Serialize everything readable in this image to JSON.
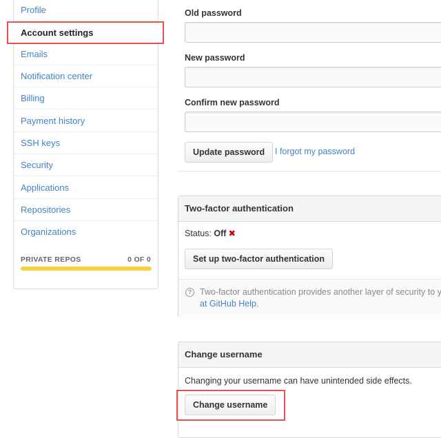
{
  "sidebar": {
    "items": [
      {
        "label": "Profile"
      },
      {
        "label": "Account settings"
      },
      {
        "label": "Emails"
      },
      {
        "label": "Notification center"
      },
      {
        "label": "Billing"
      },
      {
        "label": "Payment history"
      },
      {
        "label": "SSH keys"
      },
      {
        "label": "Security"
      },
      {
        "label": "Applications"
      },
      {
        "label": "Repositories"
      },
      {
        "label": "Organizations"
      }
    ],
    "selected": "Account settings",
    "private_repos": {
      "label": "PRIVATE REPOS",
      "count": "0 OF 0",
      "fill": 1.0,
      "bar_color": "#f5d23b"
    }
  },
  "password": {
    "old_label": "Old password",
    "new_label": "New password",
    "confirm_label": "Confirm new password",
    "update_button": "Update password",
    "forgot_link": "I forgot my password"
  },
  "two_factor": {
    "title": "Two-factor authentication",
    "status_label": "Status:",
    "status_value": "Off",
    "status_icon": "x-icon",
    "setup_button": "Set up two-factor authentication",
    "help_line1": "Two-factor authentication provides another layer of security to you",
    "help_line2_link": "at GitHub Help",
    "help_line2_end": "."
  },
  "change_username": {
    "title": "Change username",
    "warning": "Changing your username can have unintended side effects.",
    "button": "Change username"
  },
  "colors": {
    "link": "#4183c4",
    "highlight": "#e3534f",
    "status_off": "#cc0000"
  }
}
